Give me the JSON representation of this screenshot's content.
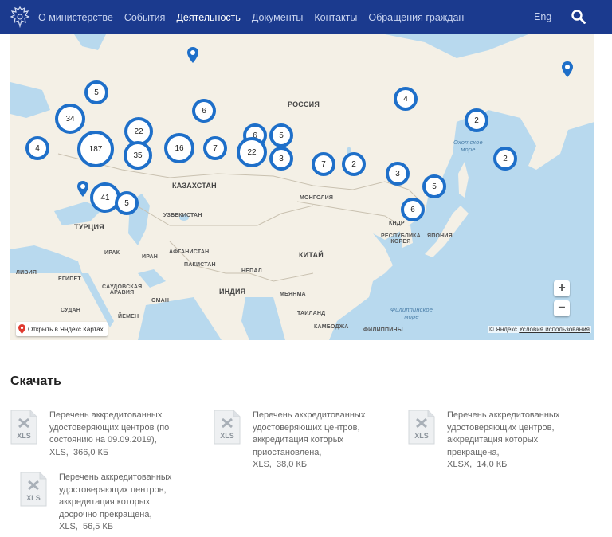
{
  "header": {
    "nav": [
      "О министерстве",
      "События",
      "Деятельность",
      "Документы",
      "Контакты",
      "Обращения граждан"
    ],
    "active_index": 2,
    "lang": "Eng",
    "brand_color": "#1b3a8e"
  },
  "map": {
    "labels": {
      "russia": "РОССИЯ",
      "kazakhstan": "КАЗАХСТАН",
      "mongolia": "МОНГОЛИЯ",
      "china": "КИТАЙ",
      "india": "ИНДИЯ",
      "turkey": "ТУРЦИЯ",
      "iraq": "ИРАК",
      "iran": "ИРАН",
      "afghanistan": "АФГАНИСТАН",
      "pakistan": "ПАКИСТАН",
      "uzbekistan": "УЗБЕКИСТАН",
      "libya": "ЛИВИЯ",
      "egypt": "ЕГИПЕТ",
      "saudi": "САУДОВСКАЯ\nАРАВИЯ",
      "oman": "ОМАН",
      "sudan": "СУДАН",
      "yemen": "ЙЕМЕН",
      "nepal": "НЕПАЛ",
      "myanmar": "МЬЯНМА",
      "thailand": "ТАИЛАНД",
      "cambodia": "КАМБОДЖА",
      "philippines": "ФИЛИППИНЫ",
      "japan": "ЯПОНИЯ",
      "korea": "РЕСПУБЛИКА\nКОРЕЯ",
      "kndr": "КНДР",
      "okhotsk": "Охотское\nморе",
      "philippine_sea": "Филиппинское\nморе"
    },
    "clusters": [
      "5",
      "6",
      "4",
      "34",
      "22",
      "6",
      "5",
      "4",
      "187",
      "35",
      "16",
      "7",
      "22",
      "3",
      "7",
      "2",
      "3",
      "5",
      "6",
      "2",
      "2",
      "41",
      "5"
    ],
    "zoom_in": "+",
    "zoom_out": "−",
    "open_label": "Открыть в Яндекс.Картах",
    "copyright": "© Яндекс",
    "terms": "Условия использования",
    "cluster_color": "#1e6fc9"
  },
  "downloads": {
    "title": "Скачать",
    "items": [
      {
        "title": "Перечень аккредитованных удостоверяющих центров (по состоянию на 09.09.2019),",
        "ext": "XLS",
        "size": "366,0 КБ",
        "icon": "XLS"
      },
      {
        "title": "Перечень аккредитованных удостоверяющих центров, аккредитация которых приостановлена,",
        "ext": "XLS",
        "size": "38,0 КБ",
        "icon": "XLS"
      },
      {
        "title": "Перечень аккредитованных удостоверяющих центров, аккредитация которых прекращена,",
        "ext": "XLSX",
        "size": "14,0 КБ",
        "icon": "XLS"
      },
      {
        "title": "Перечень аккредитованных удостоверяющих центров, аккредитация которых досрочно прекращена,",
        "ext": "XLS",
        "size": "56,5 КБ",
        "icon": "XLS"
      }
    ]
  }
}
